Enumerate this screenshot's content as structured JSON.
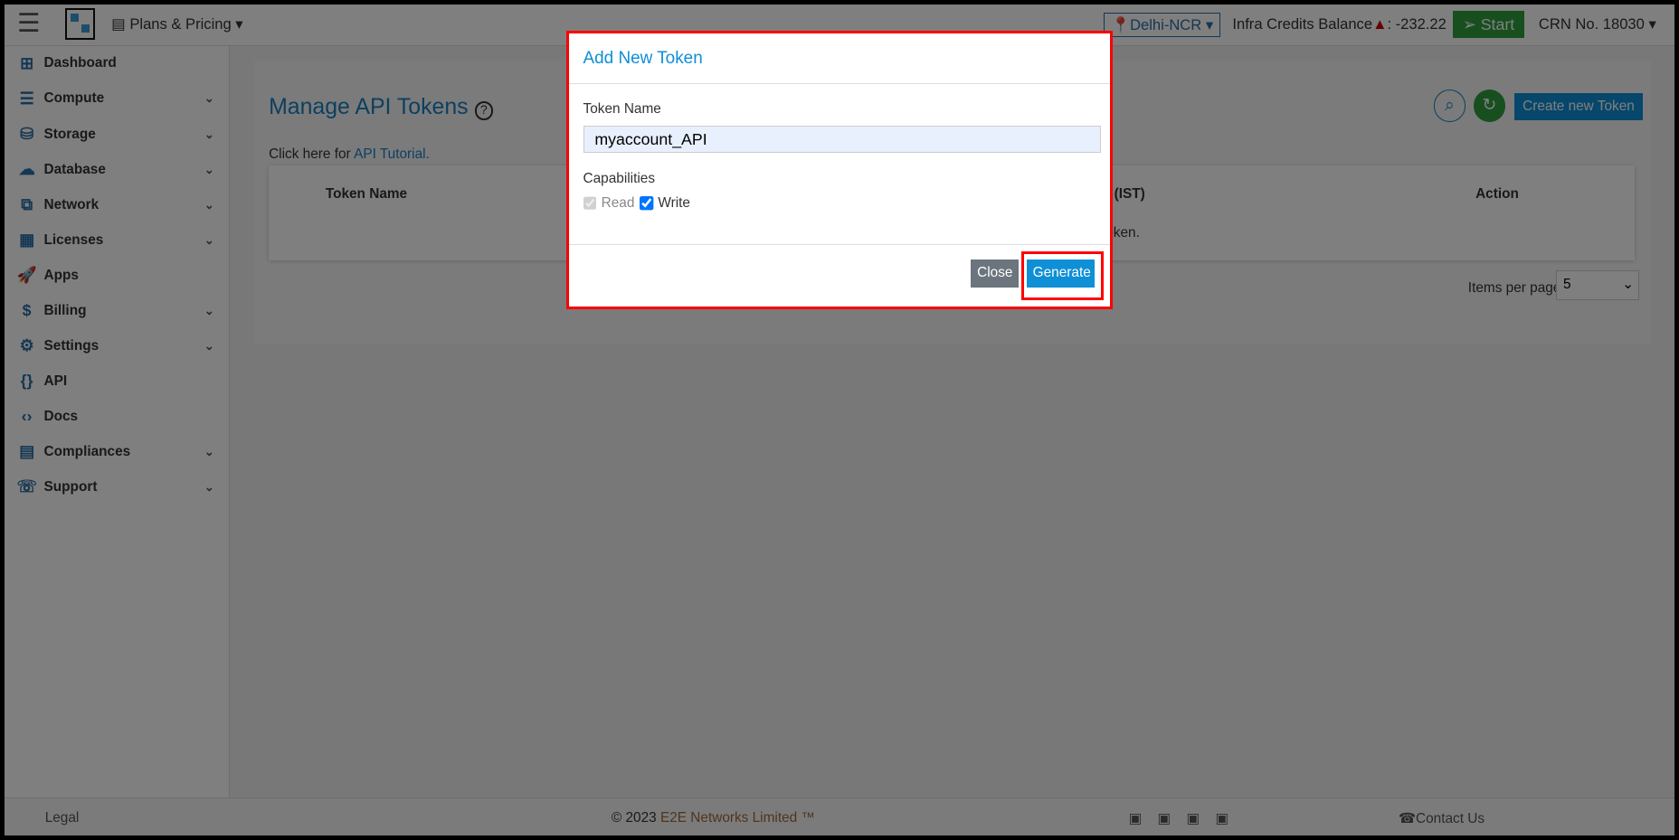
{
  "header": {
    "plans_label": "Plans & Pricing",
    "region": "Delhi-NCR",
    "credits_label": "Infra Credits Balance",
    "credits_value": ": -232.22",
    "start_label": "Start",
    "crn": "CRN No. 18030"
  },
  "sidebar": {
    "items": [
      {
        "label": "Dashboard",
        "icon": "dashboard-icon",
        "chev": false
      },
      {
        "label": "Compute",
        "icon": "server-icon",
        "chev": true
      },
      {
        "label": "Storage",
        "icon": "database-icon",
        "chev": true
      },
      {
        "label": "Database",
        "icon": "cloud-icon",
        "chev": true
      },
      {
        "label": "Network",
        "icon": "network-icon",
        "chev": true
      },
      {
        "label": "Licenses",
        "icon": "grid-icon",
        "chev": true
      },
      {
        "label": "Apps",
        "icon": "rocket-icon",
        "chev": false
      },
      {
        "label": "Billing",
        "icon": "billing-icon",
        "chev": true
      },
      {
        "label": "Settings",
        "icon": "gear-icon",
        "chev": true
      },
      {
        "label": "API",
        "icon": "braces-icon",
        "chev": false
      },
      {
        "label": "Docs",
        "icon": "code-icon",
        "chev": false
      },
      {
        "label": "Compliances",
        "icon": "document-icon",
        "chev": true
      },
      {
        "label": "Support",
        "icon": "support-icon",
        "chev": true
      }
    ]
  },
  "main": {
    "title": "Manage API Tokens",
    "tutorial_prefix": "Click here for ",
    "tutorial_link": "API Tutorial.",
    "create_label": "Create new Token",
    "columns": [
      "Token Name",
      "n (IST)",
      "Action"
    ],
    "empty_text": "token.",
    "items_per_page_label": "Items per page",
    "items_per_page": "5"
  },
  "modal": {
    "title": "Add New Token",
    "token_name_label": "Token Name",
    "token_name_value": "myaccount_API",
    "capabilities_label": "Capabilities",
    "read_label": "Read",
    "write_label": "Write",
    "read_checked": true,
    "write_checked": true,
    "close_label": "Close",
    "generate_label": "Generate"
  },
  "footer": {
    "legal": "Legal",
    "copyright_prefix": "© 2023 ",
    "company": "E2E Networks Limited ™",
    "contact": "Contact Us",
    "social": [
      "linkedin-icon",
      "facebook-icon",
      "twitter-icon",
      "rss-icon"
    ]
  },
  "colors": {
    "accent": "#0f8fd6",
    "start": "#2e9e3f",
    "highlight": "#ff0000"
  }
}
